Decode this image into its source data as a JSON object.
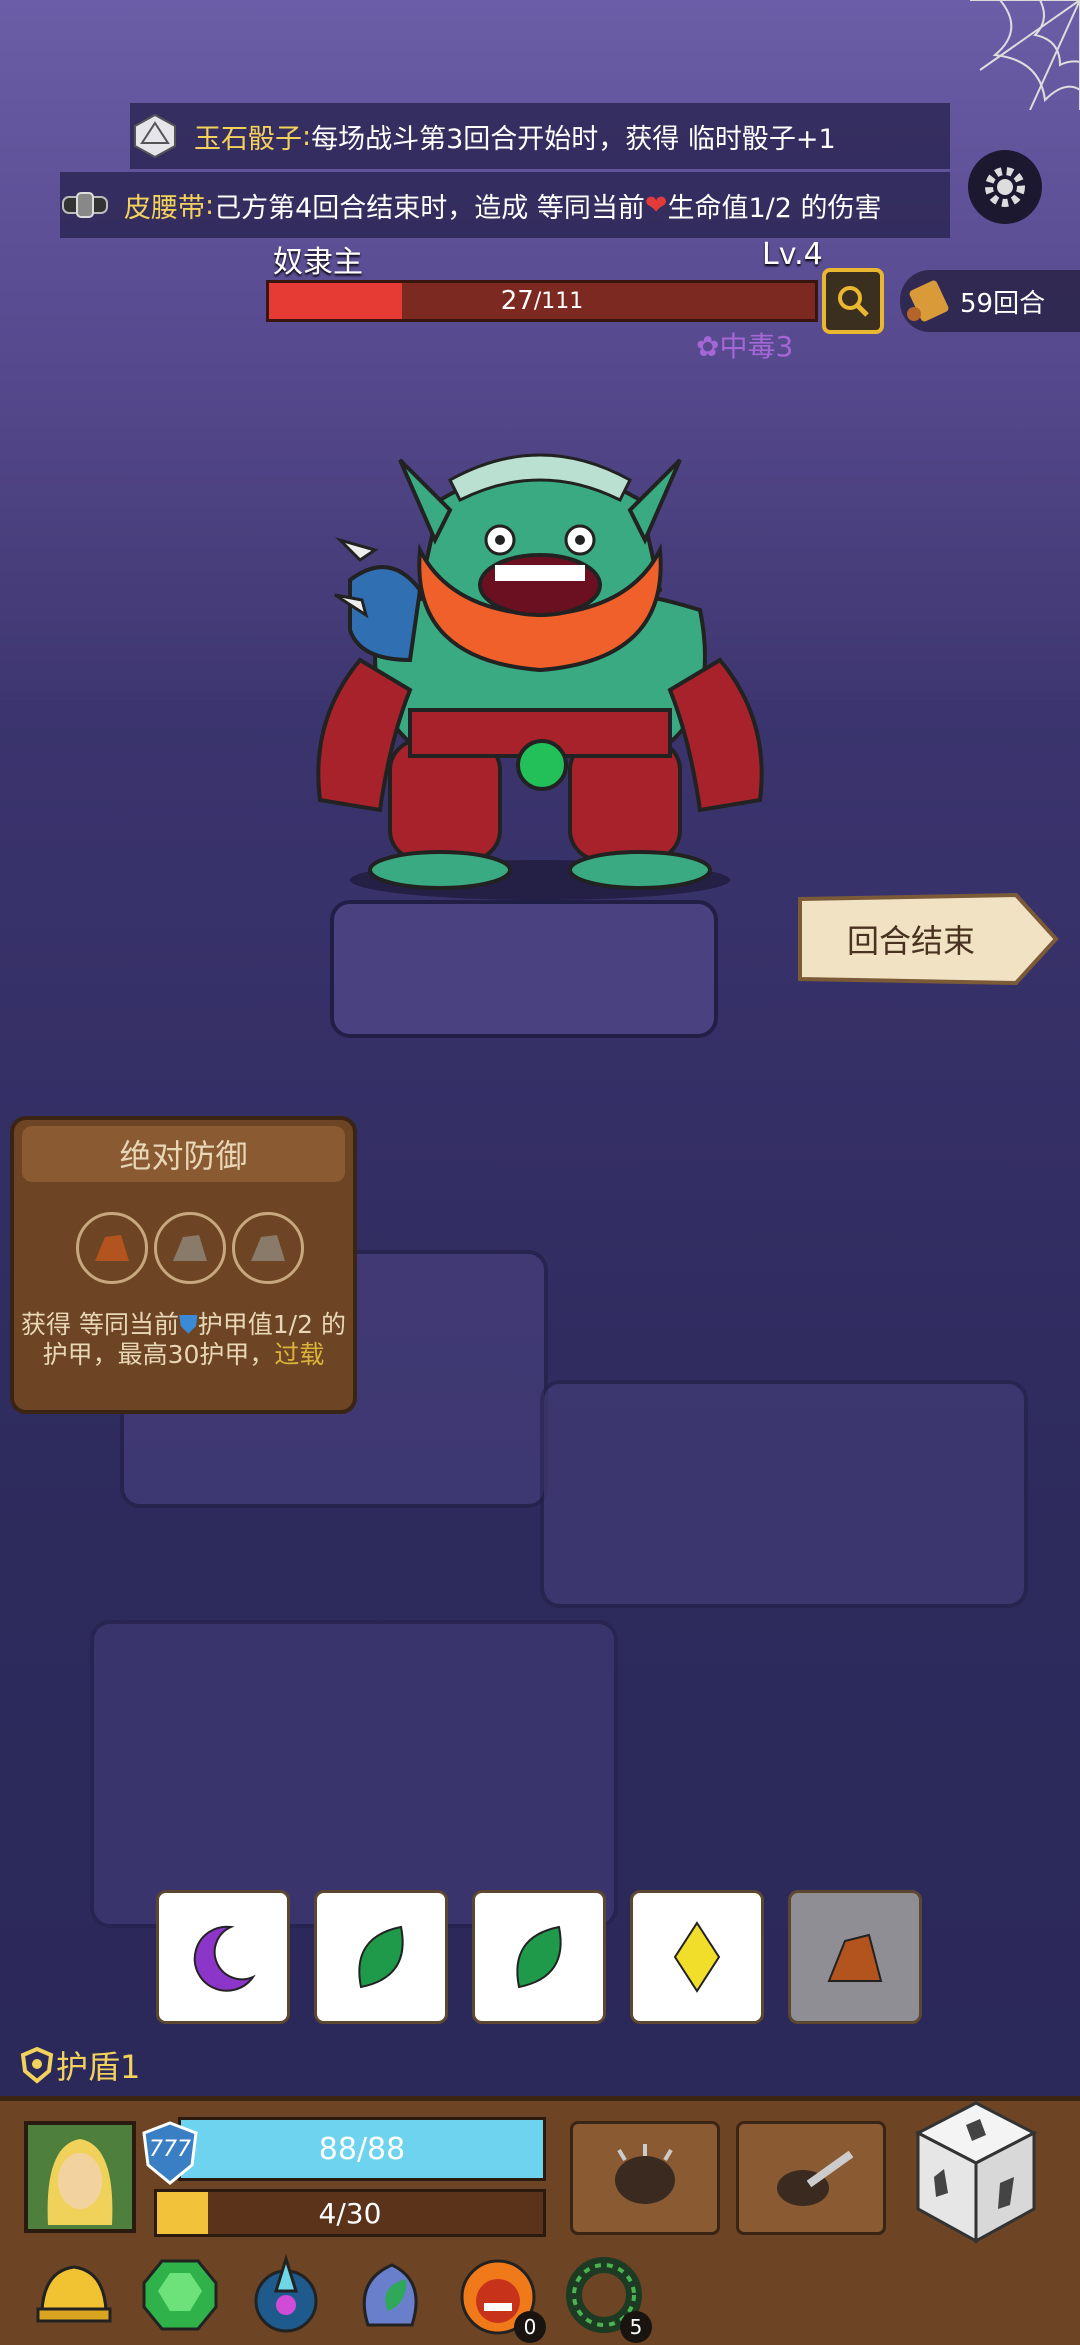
{
  "relic_effects": [
    {
      "icon": "d20-dice-icon",
      "name": "玉石骰子",
      "sep": ": ",
      "text": "每场战斗第3回合开始时，获得 临时骰子+1"
    },
    {
      "icon": "belt-icon",
      "name": "皮腰带",
      "sep": ": ",
      "text_before": "己方第4回合结束时，造成 等同当前",
      "text_after": "生命值1/2 的伤害"
    }
  ],
  "enemy": {
    "name": "奴隶主",
    "level": "Lv.4",
    "hp_text": "27",
    "hp_max_text": " /111",
    "hp": 27,
    "hp_max": 111,
    "status": "中毒3"
  },
  "rounds_text": "59回合",
  "end_turn_label": "回合结束",
  "skill": {
    "title": "绝对防御",
    "desc_before": "获得 等同当前",
    "desc_mid": "护甲值1/2 的护甲，最高30护甲，",
    "overload": "过载"
  },
  "dice_row": [
    {
      "face": "moon",
      "color": "#8b35c9",
      "used": false
    },
    {
      "face": "leaf",
      "color": "#1f9a4a",
      "used": false
    },
    {
      "face": "leaf",
      "color": "#1f9a4a",
      "used": false
    },
    {
      "face": "diamond",
      "color": "#f0de2a",
      "used": false
    },
    {
      "face": "rock",
      "color": "#b3541e",
      "used": true
    }
  ],
  "shield_label": "护盾1",
  "player": {
    "armor_value": "777",
    "hp_text": "88/88",
    "energy_text": "4/30",
    "energy_fraction": 0.133
  },
  "relic_bar": [
    {
      "icon": "golden-helmet-icon",
      "count": ""
    },
    {
      "icon": "green-gem-icon",
      "count": ""
    },
    {
      "icon": "blue-crystal-crown-icon",
      "count": ""
    },
    {
      "icon": "potion-leaf-icon",
      "count": ""
    },
    {
      "icon": "fire-mask-icon",
      "count": "0"
    },
    {
      "icon": "dark-ring-icon",
      "count": "5"
    }
  ],
  "colors": {
    "hp": "#e63b35",
    "player_hp": "#6ed3ef",
    "energy": "#f2c23a",
    "gold_text": "#f3d25c",
    "poison": "#a566d6"
  }
}
